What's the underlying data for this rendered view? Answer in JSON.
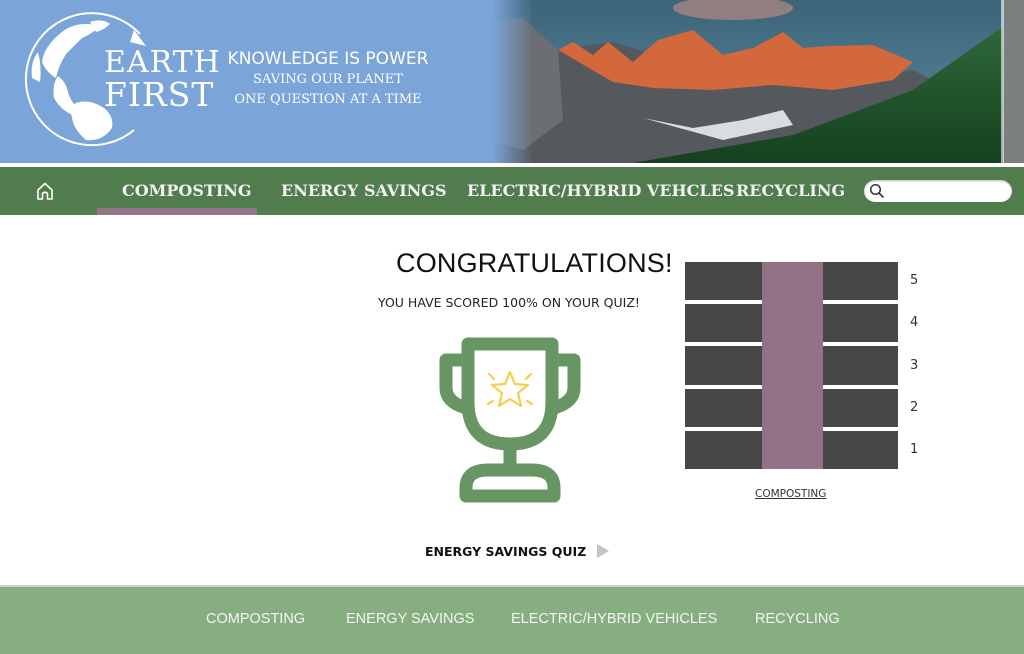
{
  "header": {
    "logo": {
      "line1": "EARTH",
      "line2": "FIRST",
      "icon": "globe-icon"
    },
    "tagline": {
      "title": "KNOWLEDGE IS POWER",
      "line2": "SAVING OUR PLANET",
      "line3": "ONE QUESTION AT A TIME"
    },
    "hero_image": "mountain-forest-landscape"
  },
  "nav": {
    "home_icon": "home-icon",
    "items": [
      {
        "label": "COMPOSTING",
        "active": true
      },
      {
        "label": "ENERGY SAVINGS",
        "active": false
      },
      {
        "label": "ELECTRIC/HYBRID VEHCLES",
        "active": false
      },
      {
        "label": "RECYCLING",
        "active": false
      }
    ],
    "search": {
      "value": "",
      "placeholder": "",
      "icon": "search-icon"
    }
  },
  "main": {
    "title": "CONGRATULATIONS!",
    "score_message": "YOU HAVE SCORED 100% ON YOUR  QUIZ!",
    "score_percent": 100,
    "trophy_icon": "trophy-icon",
    "progress": {
      "category": "COMPOSTING",
      "levels": [
        "5",
        "4",
        "3",
        "2",
        "1"
      ],
      "current_level": 5,
      "max_level": 5
    },
    "next_quiz": {
      "label": "ENERGY SAVINGS QUIZ",
      "icon": "play-arrow-icon"
    }
  },
  "colors": {
    "header_bg": "#7ba4d8",
    "nav_bg": "#517c4d",
    "active_accent": "#977589",
    "progress_fill": "#937285",
    "progress_empty": "#474747",
    "trophy": "#679563",
    "star": "#f5cf4a",
    "footer_bg": "#87ae80"
  },
  "footer": {
    "links": [
      "COMPOSTING",
      "ENERGY SAVINGS",
      "ELECTRIC/HYBRID VEHICLES",
      "RECYCLING"
    ]
  }
}
